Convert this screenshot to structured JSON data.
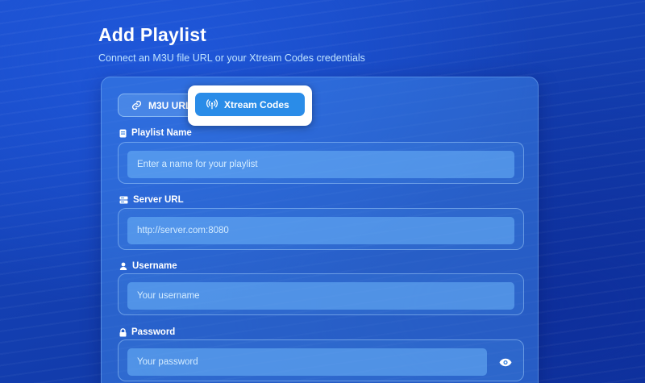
{
  "header": {
    "title": "Add Playlist",
    "subtitle": "Connect an M3U file URL or your Xtream Codes credentials"
  },
  "tabs": [
    {
      "label": "M3U URL",
      "icon": "link-icon",
      "selected": false
    },
    {
      "label": "Xtream Codes",
      "icon": "broadcast-icon",
      "selected": true
    }
  ],
  "fields": {
    "playlist_name": {
      "label": "Playlist Name",
      "icon": "document-icon",
      "value": "",
      "placeholder": "Enter a name for your playlist"
    },
    "server_url": {
      "label": "Server URL",
      "icon": "server-icon",
      "value": "",
      "placeholder": "http://server.com:8080"
    },
    "username": {
      "label": "Username",
      "icon": "user-icon",
      "value": "",
      "placeholder": "Your username"
    },
    "password": {
      "label": "Password",
      "icon": "lock-icon",
      "value": "",
      "placeholder": "Your password",
      "toggle_icon": "eye-icon"
    }
  },
  "colors": {
    "background": "#1646bd",
    "accent": "#2a8ce8",
    "subtitle": "#bfe3ff"
  }
}
